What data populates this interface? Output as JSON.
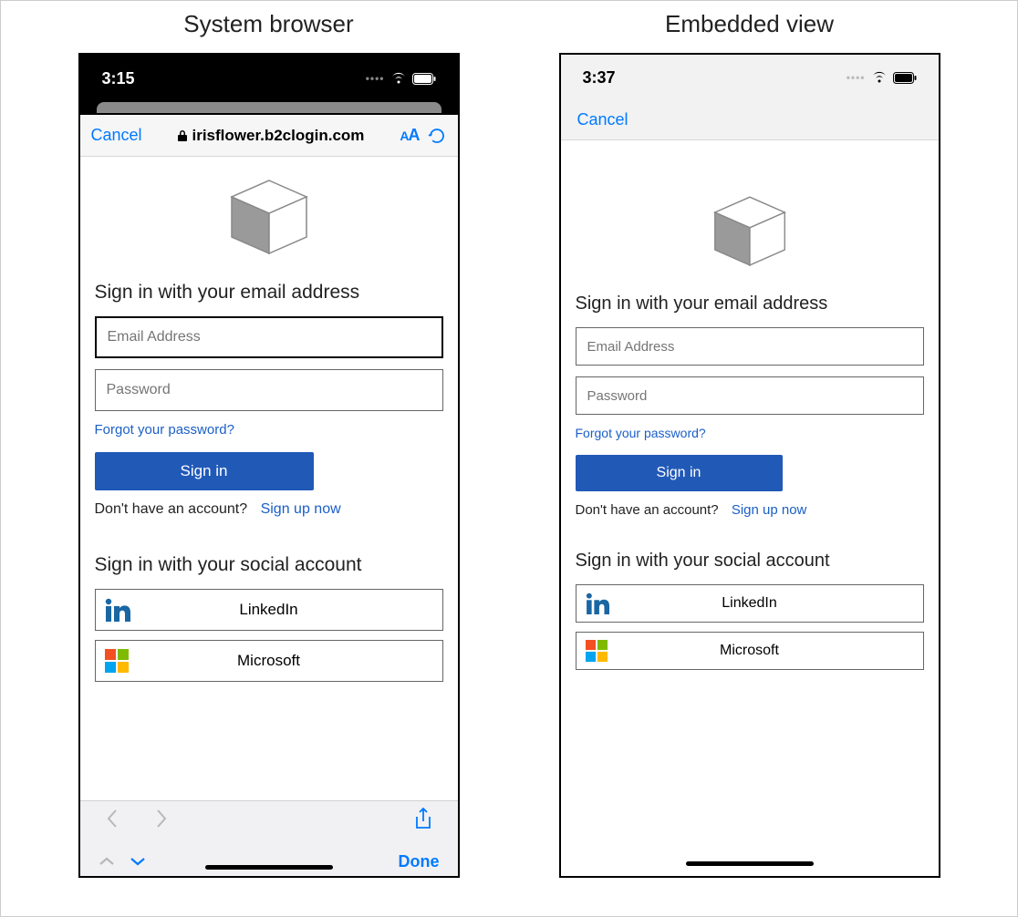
{
  "titles": {
    "left": "System browser",
    "right": "Embedded view"
  },
  "status": {
    "left_time": "3:15",
    "right_time": "3:37"
  },
  "browser": {
    "cancel": "Cancel",
    "url": "irisflower.b2clogin.com",
    "aa_small": "A",
    "aa_big": "A"
  },
  "embedded": {
    "cancel": "Cancel"
  },
  "signin": {
    "heading": "Sign in with your email address",
    "email_placeholder": "Email Address",
    "password_placeholder": "Password",
    "forgot": "Forgot your password?",
    "button": "Sign in",
    "no_account": "Don't have an account?",
    "signup": "Sign up now",
    "social_heading": "Sign in with your social account",
    "linkedin": "LinkedIn",
    "microsoft": "Microsoft"
  },
  "toolbar": {
    "done": "Done"
  }
}
